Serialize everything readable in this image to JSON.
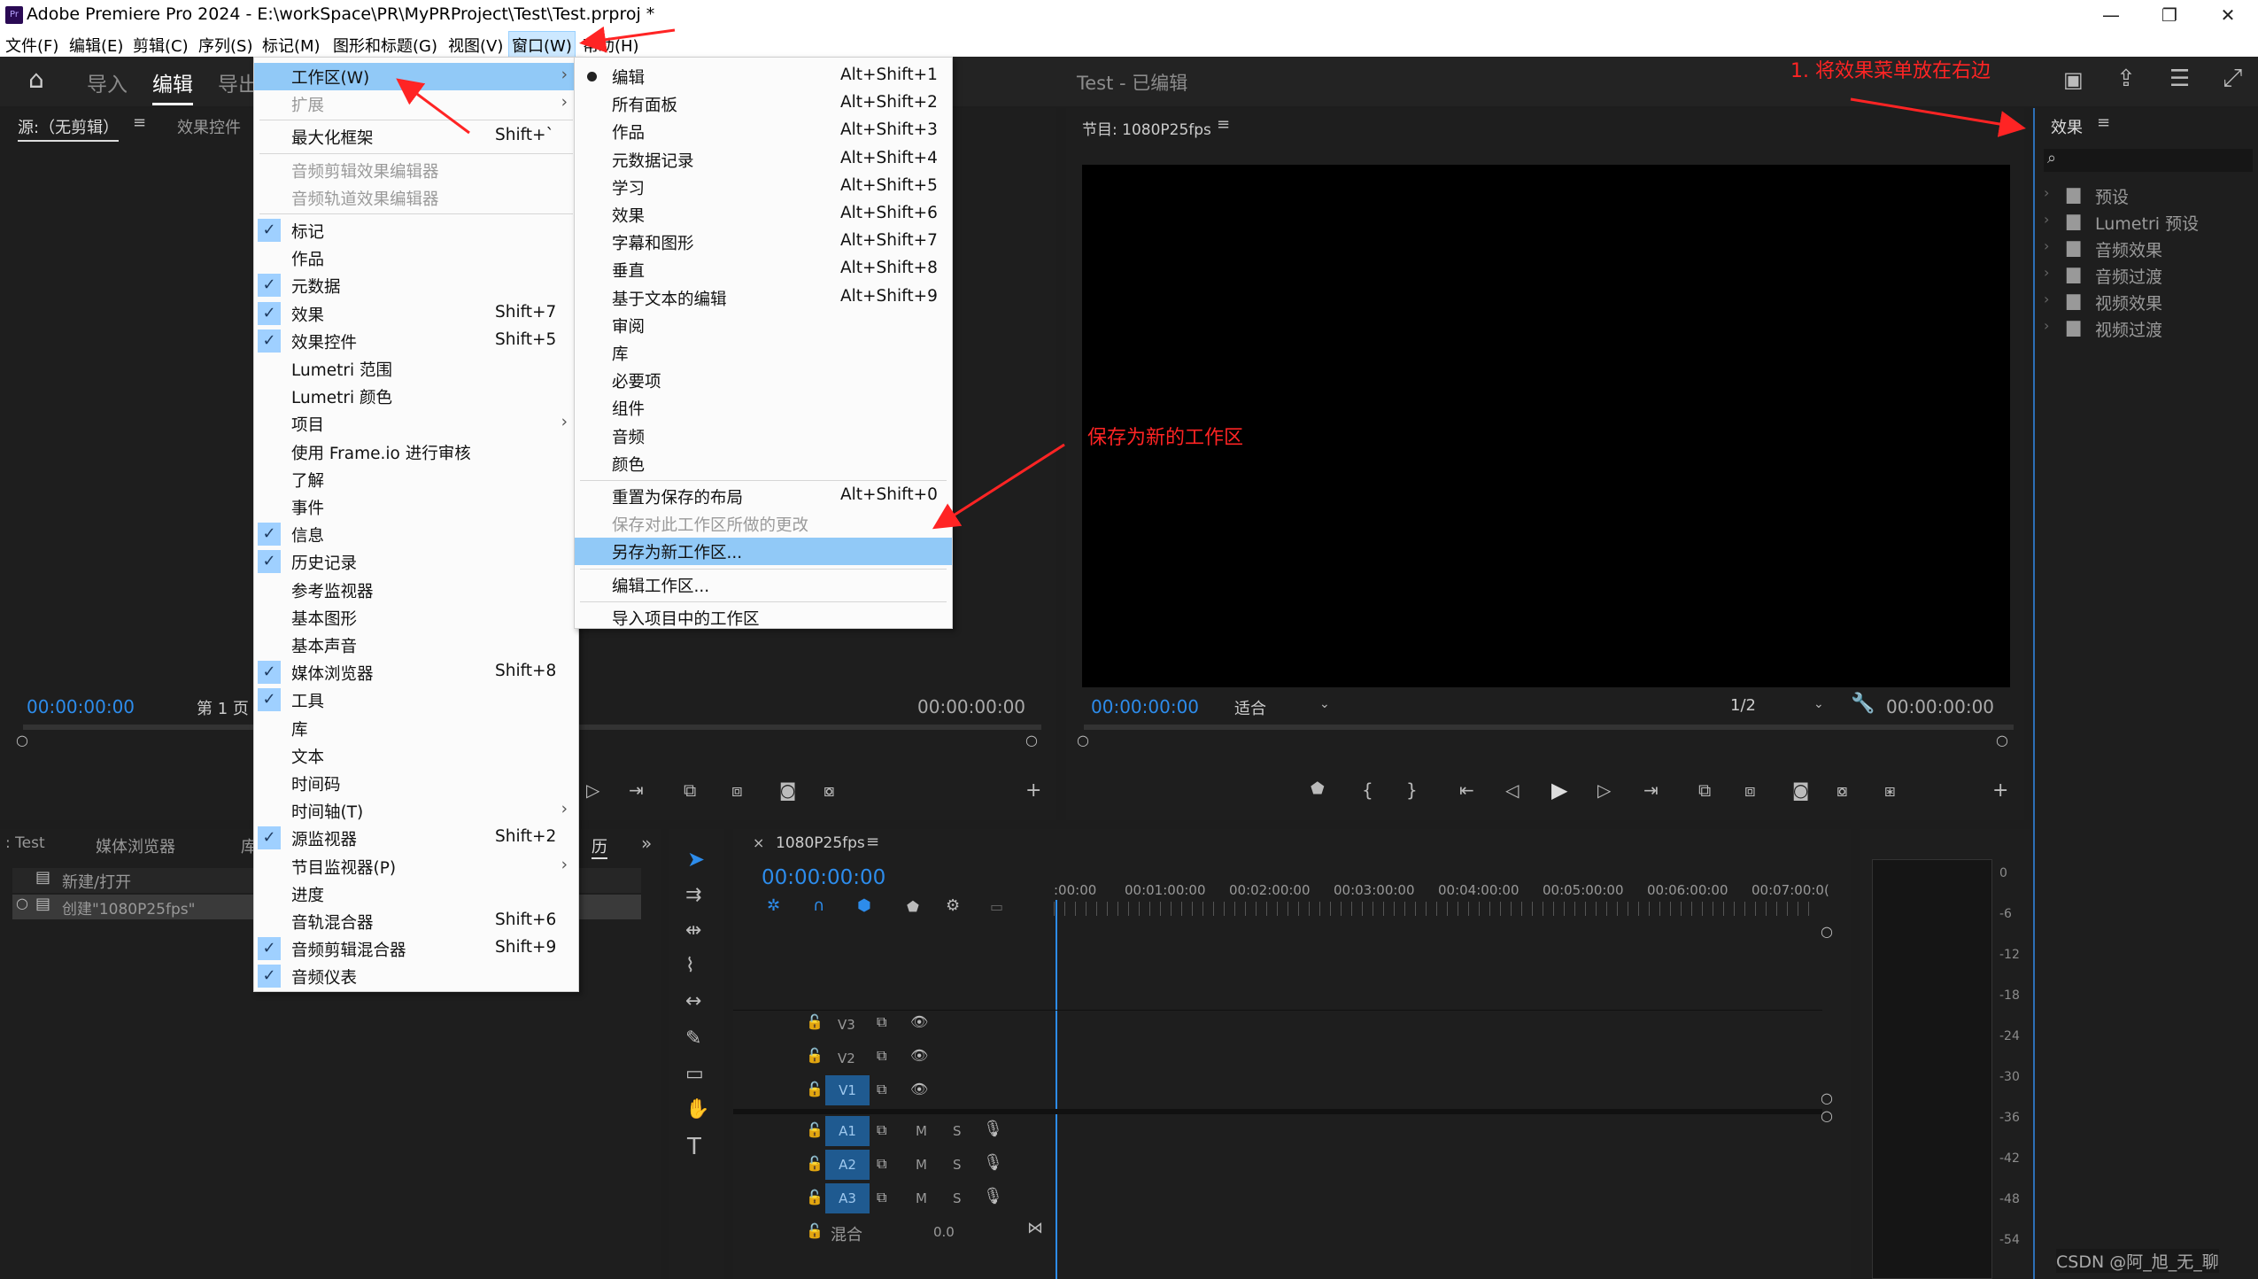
{
  "app": {
    "title": "Adobe Premiere Pro 2024 - E:\\workSpace\\PR\\MyPRProject\\Test\\Test.prproj *",
    "logo": "Pr"
  },
  "window_buttons": {
    "minimize": "—",
    "restore": "❐",
    "close": "✕"
  },
  "menubar": [
    "文件(F)",
    "编辑(E)",
    "剪辑(C)",
    "序列(S)",
    "标记(M)",
    "图形和标题(G)",
    "视图(V)",
    "窗口(W)",
    "帮助(H)"
  ],
  "header": {
    "nav": [
      "导入",
      "编辑",
      "导出"
    ],
    "active_index": 1,
    "project_title": "Test - 已编辑"
  },
  "source_panel": {
    "tabs": [
      "源:（无剪辑）",
      "效果控件"
    ],
    "timecode_left": "00:00:00:00",
    "page": "第 1 页",
    "timecode_right": "00:00:00:00"
  },
  "program_panel": {
    "title": "节目: 1080P25fps",
    "timecode": "00:00:00:00",
    "fit": "适合",
    "quality": "1/2",
    "timecode_right": "00:00:00:00"
  },
  "project_panel": {
    "tabs": [
      ": Test",
      "媒体浏览器",
      "库"
    ],
    "items": [
      "新建/打开",
      "创建\"1080P25fps\""
    ]
  },
  "history_tab": "历",
  "timeline": {
    "sequence": "1080P25fps",
    "timecode": "00:00:00:00",
    "ruler": [
      ":00:00",
      "00:01:00:00",
      "00:02:00:00",
      "00:03:00:00",
      "00:04:00:00",
      "00:05:00:00",
      "00:06:00:00",
      "00:07:00:0("
    ],
    "video_tracks": [
      "V3",
      "V2",
      "V1"
    ],
    "audio_tracks": [
      "A1",
      "A2",
      "A3"
    ],
    "mix_label": "混合",
    "mix_value": "0.0",
    "m": "M",
    "s": "S"
  },
  "effects_panel": {
    "title": "效果",
    "items": [
      "预设",
      "Lumetri 预设",
      "音频效果",
      "音频过渡",
      "视频效果",
      "视频过渡"
    ]
  },
  "audio_meter": {
    "scale": [
      "0",
      "-6",
      "-12",
      "-18",
      "-24",
      "-30",
      "-36",
      "-42",
      "-48",
      "-54"
    ]
  },
  "window_menu": {
    "items": [
      {
        "label": "工作区(W)",
        "submenu": true,
        "highlight": true
      },
      {
        "label": "扩展",
        "submenu": true,
        "disabled": true
      },
      {
        "label": "最大化框架",
        "shortcut": "Shift+`"
      },
      {
        "label": "音频剪辑效果编辑器",
        "disabled": true
      },
      {
        "label": "音频轨道效果编辑器",
        "disabled": true
      },
      {
        "label": "标记",
        "checked": true
      },
      {
        "label": "作品"
      },
      {
        "label": "元数据",
        "checked": true
      },
      {
        "label": "效果",
        "checked": true,
        "shortcut": "Shift+7"
      },
      {
        "label": "效果控件",
        "checked": true,
        "shortcut": "Shift+5"
      },
      {
        "label": "Lumetri 范围"
      },
      {
        "label": "Lumetri 颜色"
      },
      {
        "label": "项目",
        "submenu": true
      },
      {
        "label": "使用 Frame.io 进行审核"
      },
      {
        "label": "了解"
      },
      {
        "label": "事件"
      },
      {
        "label": "信息",
        "checked": true
      },
      {
        "label": "历史记录",
        "checked": true
      },
      {
        "label": "参考监视器"
      },
      {
        "label": "基本图形"
      },
      {
        "label": "基本声音"
      },
      {
        "label": "媒体浏览器",
        "checked": true,
        "shortcut": "Shift+8"
      },
      {
        "label": "工具",
        "checked": true
      },
      {
        "label": "库"
      },
      {
        "label": "文本"
      },
      {
        "label": "时间码"
      },
      {
        "label": "时间轴(T)",
        "submenu": true
      },
      {
        "label": "源监视器",
        "checked": true,
        "shortcut": "Shift+2"
      },
      {
        "label": "节目监视器(P)",
        "submenu": true
      },
      {
        "label": "进度"
      },
      {
        "label": "音轨混合器",
        "shortcut": "Shift+6"
      },
      {
        "label": "音频剪辑混合器",
        "checked": true,
        "shortcut": "Shift+9"
      },
      {
        "label": "音频仪表",
        "checked": true
      }
    ]
  },
  "workspace_menu": {
    "items": [
      {
        "label": "编辑",
        "shortcut": "Alt+Shift+1",
        "current": true
      },
      {
        "label": "所有面板",
        "shortcut": "Alt+Shift+2"
      },
      {
        "label": "作品",
        "shortcut": "Alt+Shift+3"
      },
      {
        "label": "元数据记录",
        "shortcut": "Alt+Shift+4"
      },
      {
        "label": "学习",
        "shortcut": "Alt+Shift+5"
      },
      {
        "label": "效果",
        "shortcut": "Alt+Shift+6"
      },
      {
        "label": "字幕和图形",
        "shortcut": "Alt+Shift+7"
      },
      {
        "label": "垂直",
        "shortcut": "Alt+Shift+8"
      },
      {
        "label": "基于文本的编辑",
        "shortcut": "Alt+Shift+9"
      },
      {
        "label": "审阅"
      },
      {
        "label": "库"
      },
      {
        "label": "必要项"
      },
      {
        "label": "组件"
      },
      {
        "label": "音频"
      },
      {
        "label": "颜色"
      },
      {
        "label": "重置为保存的布局",
        "shortcut": "Alt+Shift+0",
        "group": 2
      },
      {
        "label": "保存对此工作区所做的更改",
        "disabled": true,
        "group": 2
      },
      {
        "label": "另存为新工作区...",
        "highlight": true,
        "group": 2
      },
      {
        "label": "编辑工作区...",
        "group": 3
      },
      {
        "label": "导入项目中的工作区",
        "group": 4
      }
    ]
  },
  "annotations": {
    "note1": "1. 将效果菜单放在右边",
    "note2": "保存为新的工作区"
  },
  "watermark": "CSDN @阿_旭_无_聊",
  "colors": {
    "accent": "#2d8ceb",
    "annotation": "#ff2424",
    "highlight": "#91c9f7"
  }
}
